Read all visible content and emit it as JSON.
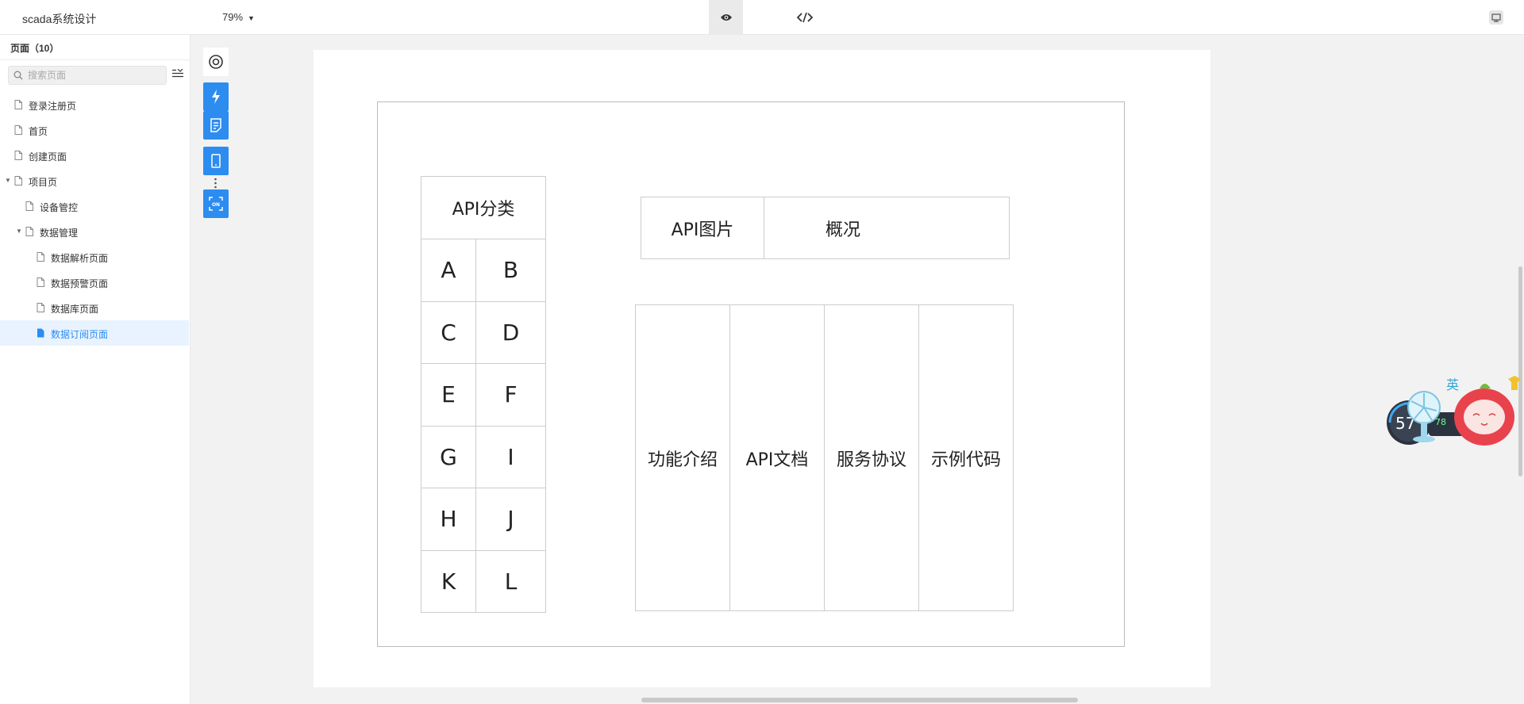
{
  "header": {
    "app_title": "scada系统设计",
    "zoom": "79%"
  },
  "sidebar": {
    "pages_header": "页面（10）",
    "search_placeholder": "搜索页面",
    "items": [
      {
        "label": "登录注册页",
        "level": 0,
        "expandable": false,
        "active": false
      },
      {
        "label": "首页",
        "level": 0,
        "expandable": false,
        "active": false
      },
      {
        "label": "创建页面",
        "level": 0,
        "expandable": false,
        "active": false
      },
      {
        "label": "项目页",
        "level": 0,
        "expandable": true,
        "active": false
      },
      {
        "label": "设备管控",
        "level": 1,
        "expandable": false,
        "active": false
      },
      {
        "label": "数据管理",
        "level": 1,
        "expandable": true,
        "active": false
      },
      {
        "label": "数据解析页面",
        "level": 2,
        "expandable": false,
        "active": false
      },
      {
        "label": "数据预警页面",
        "level": 2,
        "expandable": false,
        "active": false
      },
      {
        "label": "数据库页面",
        "level": 2,
        "expandable": false,
        "active": false
      },
      {
        "label": "数据订阅页面",
        "level": 2,
        "expandable": false,
        "active": true
      }
    ]
  },
  "canvas": {
    "category_header": "API分类",
    "category_letters": [
      "A",
      "B",
      "C",
      "D",
      "E",
      "F",
      "G",
      "I",
      "H",
      "J",
      "K",
      "L"
    ],
    "api_image": "API图片",
    "overview": "概况",
    "columns": [
      "功能介绍",
      "API文档",
      "服务协议",
      "示例代码"
    ]
  },
  "toolbar_icons": [
    "target-icon",
    "lightning-icon",
    "note-icon",
    "mobile-icon",
    "json-icon"
  ],
  "colors": {
    "accent": "#2d8cf0",
    "active_bg": "#e8f3ff"
  }
}
